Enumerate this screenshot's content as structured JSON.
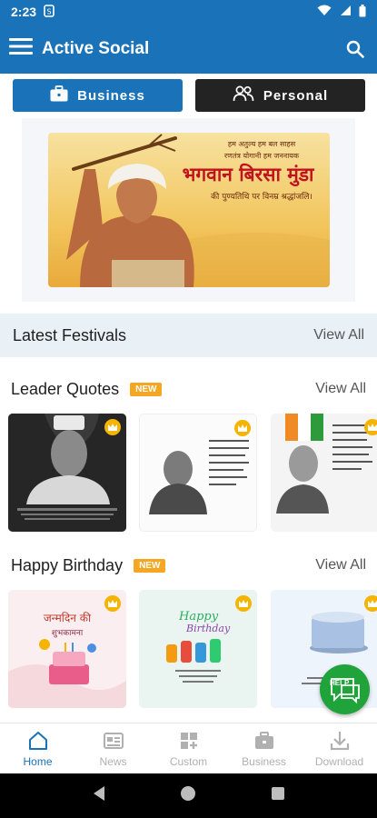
{
  "status": {
    "time": "2:23",
    "left_icon": "sync-icon",
    "icons": [
      "wifi-icon",
      "signal-icon",
      "battery-icon"
    ]
  },
  "appbar": {
    "title": "Active Social"
  },
  "segments": {
    "business": "Business",
    "personal": "Personal"
  },
  "banner": {
    "line1": "हम अतुल्य हम बल साहस",
    "line2": "रणतंत्र योगानी हम जननायक",
    "line3": "भगवान बिरसा मुंडा",
    "line4": "की पुण्यतिथि पर विनम्र श्रद्धांजलि।"
  },
  "latest": {
    "title": "Latest Festivals",
    "view_all": "View All"
  },
  "leader": {
    "title": "Leader Quotes",
    "badge": "NEW",
    "view_all": "View All"
  },
  "birthday": {
    "title": "Happy Birthday",
    "badge": "NEW",
    "view_all": "View All",
    "card1_text": "जन्मदिन की",
    "card1_sub": "शुभकामना",
    "card2_line1": "Happy",
    "card2_line2": "Birthday"
  },
  "help": {
    "label": "HELP"
  },
  "nav": [
    {
      "label": "Home",
      "icon": "home-icon"
    },
    {
      "label": "News",
      "icon": "news-icon"
    },
    {
      "label": "Custom",
      "icon": "custom-icon"
    },
    {
      "label": "Business",
      "icon": "briefcase-icon"
    },
    {
      "label": "Download",
      "icon": "download-icon"
    }
  ],
  "colors": {
    "primary": "#1a73b8",
    "dark": "#232323",
    "badge": "#f5a623",
    "help": "#1fa33a"
  }
}
